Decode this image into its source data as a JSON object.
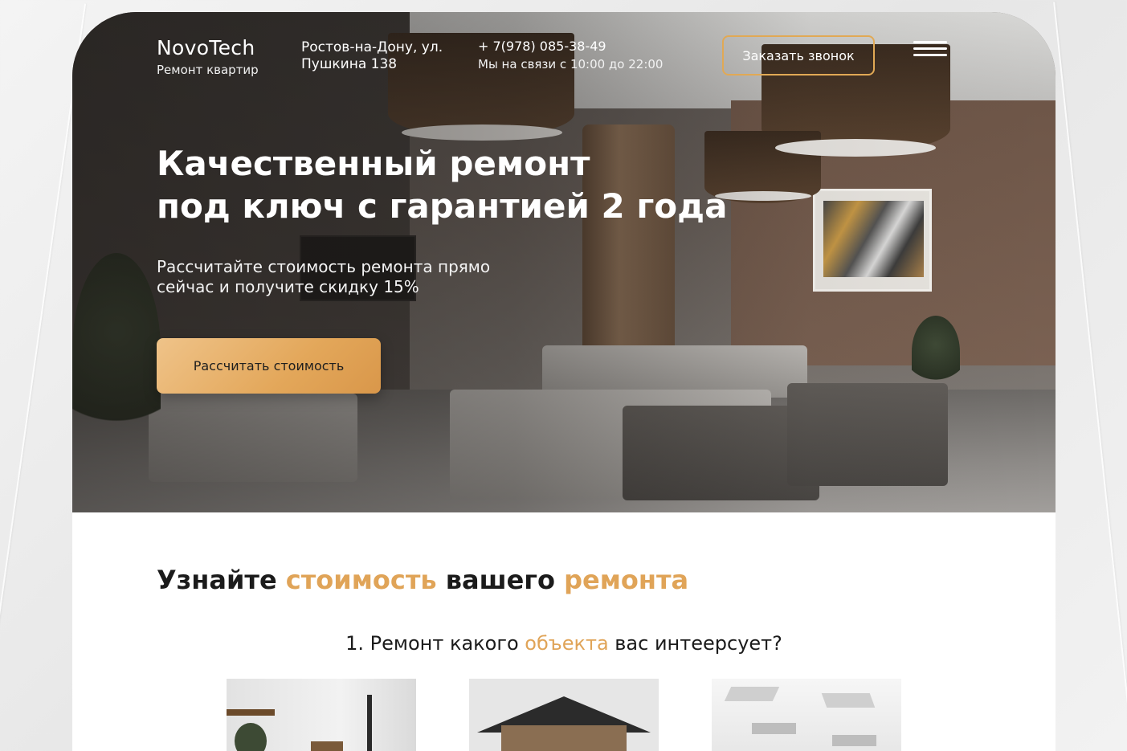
{
  "header": {
    "brand_name": "NovoTech",
    "brand_subtitle": "Ремонт квартир",
    "address_line1": "Ростов-на-Дону, ул.",
    "address_line2": "Пушкина 138",
    "phone": "+ 7(978) 085-38-49",
    "hours": "Мы на связи с 10:00 до 22:00",
    "callback_label": "Заказать звонок",
    "menu_icon": "hamburger-icon"
  },
  "hero": {
    "title_line1": "Качественный ремонт",
    "title_line2": "под ключ с гарантией 2 года",
    "subtitle_line1": "Рассчитайте стоимость ремонта прямо",
    "subtitle_line2": "сейчас и получите скидку 15%",
    "cta_label": "Рассчитать стоимость"
  },
  "calculator": {
    "title_part1": "Узнайте ",
    "title_accent1": "стоимость",
    "title_part2": " вашего ",
    "title_accent2": "ремонта",
    "question_prefix": "1. Ремонт какого ",
    "question_accent": "объекта",
    "question_suffix": " вас интеерсует?"
  },
  "colors": {
    "accent": "#e0a458",
    "button_gradient_start": "#efc389",
    "button_gradient_end": "#d9974a",
    "text_dark": "#1b1b1b"
  }
}
